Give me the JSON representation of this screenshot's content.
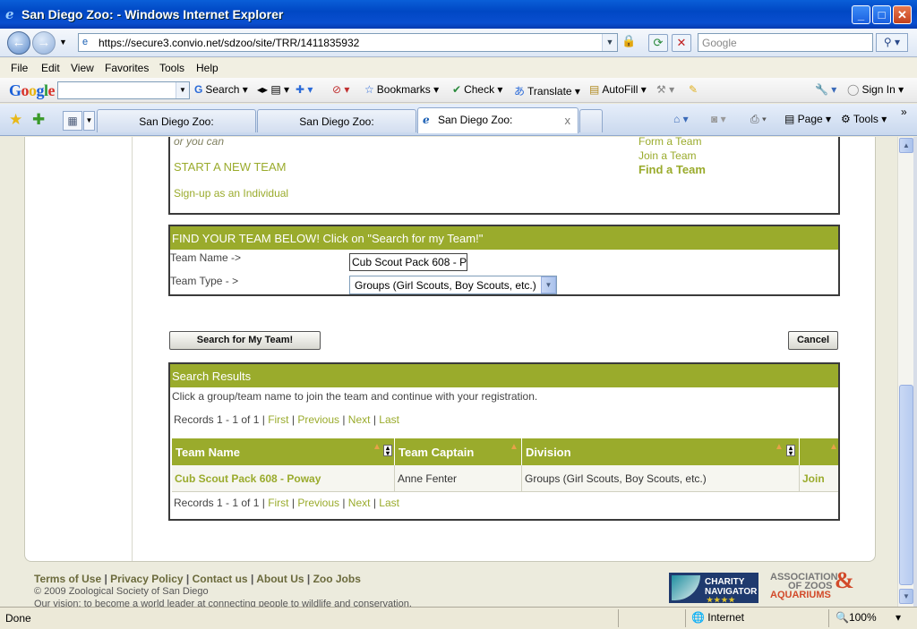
{
  "window": {
    "title": "San Diego Zoo: - Windows Internet Explorer",
    "min": "_",
    "max": "□",
    "close": "✕"
  },
  "address": {
    "url": "https://secure3.convio.net/sdzoo/site/TRR/1411835932",
    "search_placeholder": "Google"
  },
  "menu": [
    "File",
    "Edit",
    "View",
    "Favorites",
    "Tools",
    "Help"
  ],
  "google_toolbar": {
    "logo": "Google",
    "search": "Search",
    "bookmarks": "Bookmarks",
    "check": "Check",
    "translate": "Translate",
    "autofill": "AutoFill",
    "signin": "Sign In"
  },
  "tabs": [
    {
      "label": "San Diego Zoo:"
    },
    {
      "label": "San Diego Zoo:"
    },
    {
      "label": "San Diego Zoo:"
    }
  ],
  "command_bar": {
    "page": "Page",
    "tools": "Tools"
  },
  "content": {
    "or_you_can": "or you can",
    "start_team": "START A NEW TEAM",
    "signup": "Sign-up as an Individual",
    "right_links": [
      "Form a Team",
      "Join a Team",
      "Find a Team"
    ],
    "find": {
      "heading": "FIND YOUR TEAM BELOW! Click on \"Search for my Team!\"",
      "team_name_label": "Team Name ->",
      "team_name_value": "Cub Scout Pack 608 - P",
      "team_type_label": "Team Type - >",
      "team_type_value": "Groups (Girl Scouts, Boy Scouts, etc.)"
    },
    "search_button": "Search for My Team!",
    "cancel_button": "Cancel",
    "results": {
      "heading": "Search Results",
      "intro": "Click a group/team name to join the team and continue with your registration.",
      "records": "Records 1 - 1 of 1",
      "first": "First",
      "previous": "Previous",
      "next": "Next",
      "last": "Last",
      "columns": [
        "Team Name",
        "Team Captain",
        "Division"
      ],
      "rows": [
        {
          "team": "Cub Scout Pack 608 - Poway",
          "captain": "Anne Fenter",
          "division": "Groups (Girl Scouts, Boy Scouts, etc.)",
          "action": "Join"
        }
      ]
    }
  },
  "footer": {
    "links": [
      "Terms of Use",
      "Privacy Policy",
      "Contact us",
      "About Us",
      "Zoo Jobs"
    ],
    "copyright": "© 2009 Zoological Society of San Diego",
    "vision": "Our vision: to become a world leader at connecting people to wildlife and conservation.",
    "charity_line1": "CHARITY",
    "charity_line2": "NAVIGATOR",
    "aza_line1": "ASSOCIATION",
    "aza_line2": "OF ZOOS",
    "aza_line3": "AQUARIUMS"
  },
  "status": {
    "text": "Done",
    "zone": "Internet",
    "zoom": "100%"
  }
}
